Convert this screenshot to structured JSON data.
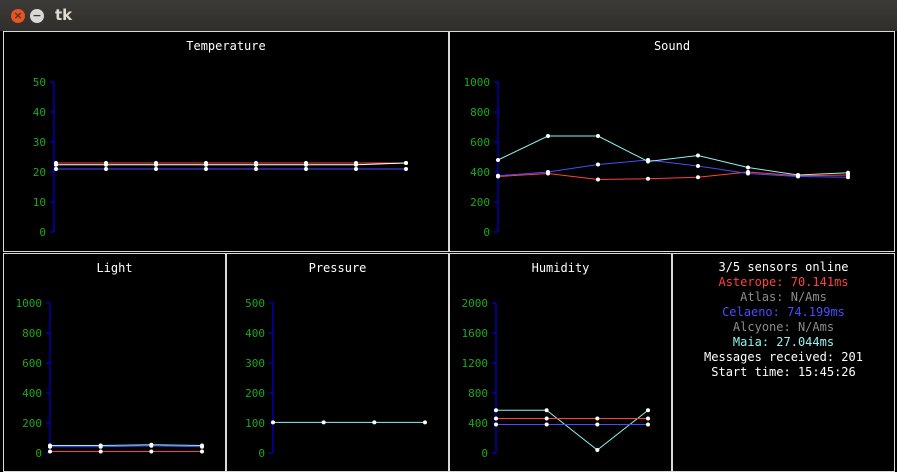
{
  "window": {
    "title": "tk"
  },
  "colors": {
    "axis": "#0000ff",
    "tick": "#1ea81e",
    "asterope": "#ff4040",
    "atlas": "#ffffff",
    "celaeno": "#4b4bff",
    "maia": "#8ef4f4"
  },
  "chart_data": [
    {
      "type": "line",
      "title": "Temperature",
      "ylim": [
        0,
        50
      ],
      "yticks": [
        0,
        10,
        20,
        30,
        40,
        50
      ],
      "series": [
        {
          "name": "Asterope",
          "color": "#ff4040",
          "values": [
            23,
            23,
            23,
            23,
            23,
            23,
            23,
            23
          ]
        },
        {
          "color": "#ffffff",
          "values": [
            22.4,
            22.4,
            22.4,
            22.4,
            22.4,
            22.4,
            22.4,
            23
          ]
        },
        {
          "name": "Celaeno",
          "color": "#4b4bff",
          "values": [
            21,
            21,
            21,
            21,
            21,
            21,
            21,
            21
          ]
        }
      ]
    },
    {
      "type": "line",
      "title": "Sound",
      "ylim": [
        0,
        1000
      ],
      "yticks": [
        0,
        200,
        400,
        600,
        800,
        1000
      ],
      "series": [
        {
          "name": "Asterope",
          "color": "#ff4040",
          "values": [
            370,
            390,
            350,
            355,
            365,
            400,
            375,
            380
          ]
        },
        {
          "name": "Celaeno",
          "color": "#4b4bff",
          "values": [
            375,
            400,
            450,
            480,
            440,
            390,
            370,
            365
          ]
        },
        {
          "name": "Maia",
          "color": "#8ef4f4",
          "values": [
            480,
            640,
            640,
            470,
            510,
            430,
            380,
            395
          ]
        }
      ]
    },
    {
      "type": "line",
      "title": "Light",
      "ylim": [
        0,
        1000
      ],
      "yticks": [
        0,
        200,
        400,
        600,
        800,
        1000
      ],
      "series": [
        {
          "name": "Maia",
          "color": "#8ef4f4",
          "values": [
            50,
            50,
            55,
            50
          ]
        },
        {
          "name": "Celaeno",
          "color": "#4b4bff",
          "values": [
            42,
            42,
            48,
            42
          ]
        },
        {
          "name": "Asterope",
          "color": "#ff4040",
          "values": [
            10,
            10,
            10,
            10
          ]
        }
      ]
    },
    {
      "type": "line",
      "title": "Pressure",
      "ylim": [
        0,
        500
      ],
      "yticks": [
        0,
        100,
        200,
        300,
        400,
        500
      ],
      "series": [
        {
          "name": "Maia",
          "color": "#8ef4f4",
          "values": [
            102,
            102,
            102,
            102
          ]
        }
      ]
    },
    {
      "type": "line",
      "title": "Humidity",
      "ylim": [
        0,
        2000
      ],
      "yticks": [
        0,
        400,
        800,
        1200,
        1600,
        2000
      ],
      "series": [
        {
          "name": "Maia",
          "color": "#8ef4f4",
          "values": [
            570,
            570,
            40,
            570
          ]
        },
        {
          "name": "Asterope",
          "color": "#ff4040",
          "values": [
            460,
            460,
            460,
            460
          ]
        },
        {
          "name": "Celaeno",
          "color": "#4b4bff",
          "values": [
            380,
            380,
            380,
            380
          ]
        }
      ]
    }
  ],
  "status": {
    "online": "3/5 sensors online",
    "sensors": [
      {
        "text": "Asterope: 70.141ms",
        "color": "#ff4040"
      },
      {
        "text": "Atlas: N/Ams",
        "color": "#8c8c8c"
      },
      {
        "text": "Celaeno: 74.199ms",
        "color": "#4b4bff"
      },
      {
        "text": "Alcyone: N/Ams",
        "color": "#8c8c8c"
      },
      {
        "text": "Maia: 27.044ms",
        "color": "#8ef4f4"
      }
    ],
    "messages": "Messages received: 201",
    "start": "Start time: 15:45:26"
  }
}
